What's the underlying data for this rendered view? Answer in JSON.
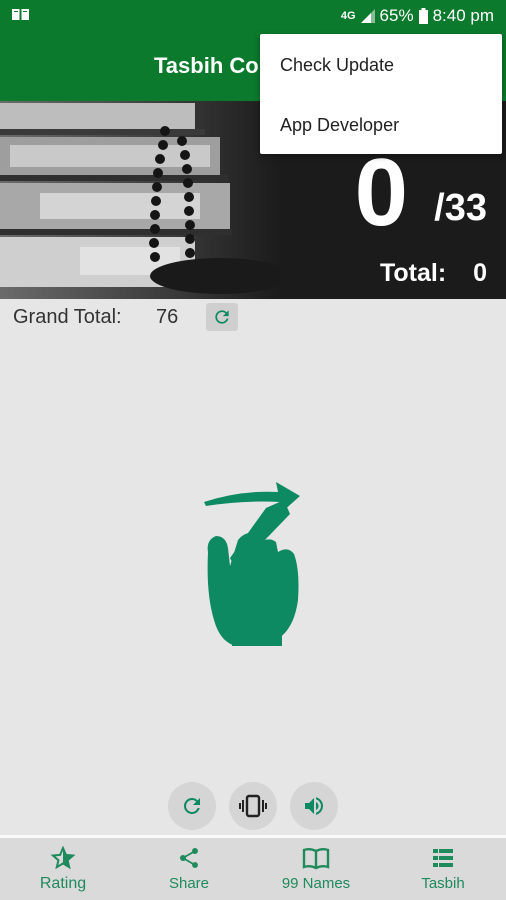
{
  "status_bar": {
    "network": "4G",
    "battery": "65%",
    "time": "8:40 pm"
  },
  "app_bar": {
    "title": "Tasbih Co"
  },
  "counter": {
    "count": "0",
    "target": "/33",
    "total_label": "Total:",
    "total_value": "0"
  },
  "grand_total": {
    "label": "Grand Total:",
    "value": "76"
  },
  "menu": {
    "items": [
      {
        "label": "Check Update"
      },
      {
        "label": "App Developer"
      }
    ]
  },
  "controls": {
    "icons": [
      "refresh-icon",
      "vibrate-icon",
      "volume-icon"
    ]
  },
  "bottom_nav": {
    "items": [
      {
        "label": "Rating",
        "icon": "star-icon"
      },
      {
        "label": "Share",
        "icon": "share-icon"
      },
      {
        "label": "99 Names",
        "icon": "book-icon"
      },
      {
        "label": "Tasbih",
        "icon": "list-icon"
      }
    ]
  },
  "colors": {
    "primary": "#0b7a2c",
    "accent": "#0e8a63",
    "nav_label": "#1f8a5c"
  }
}
